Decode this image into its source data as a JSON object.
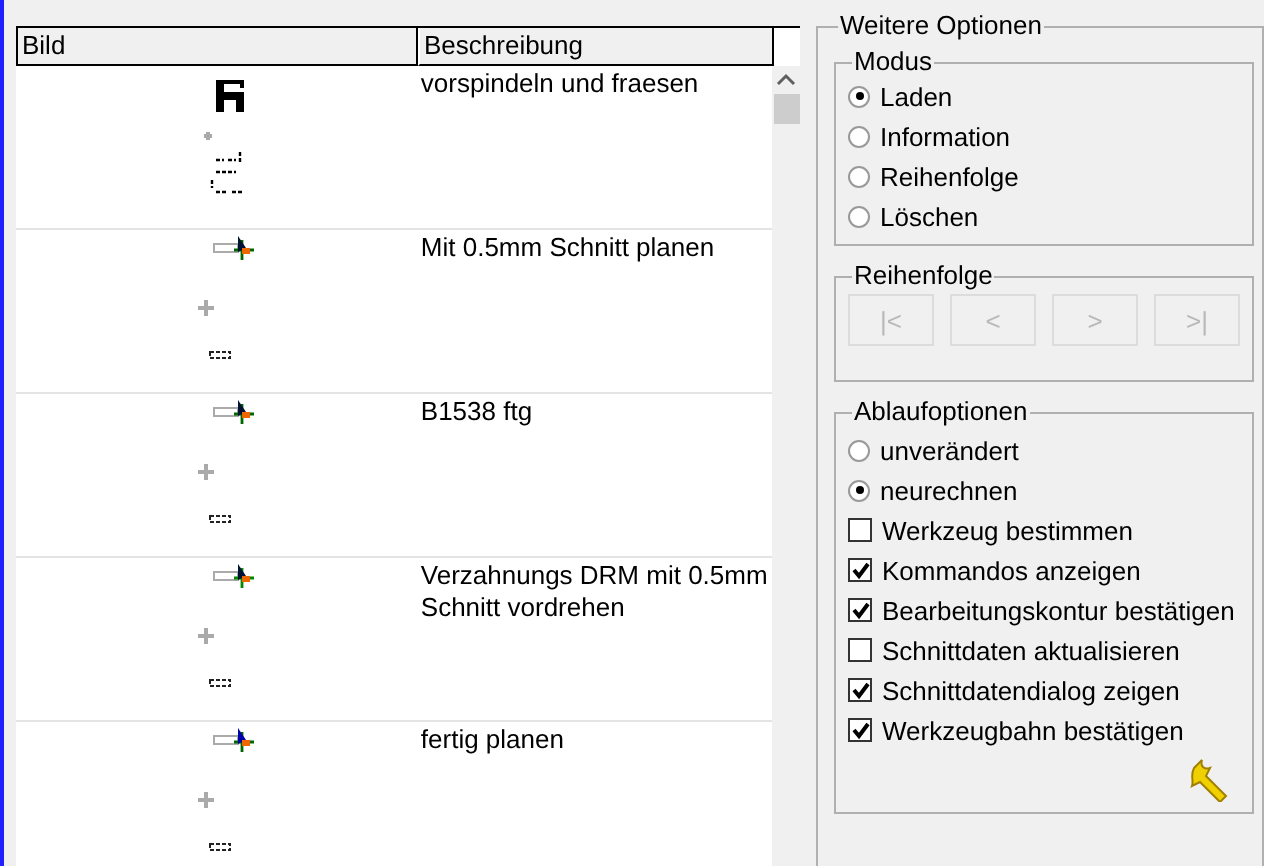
{
  "table": {
    "columns": [
      "Bild",
      "Beschreibung"
    ],
    "rows": [
      {
        "description": "vorspindeln und fraesen"
      },
      {
        "description": "Mit  0.5mm Schnitt planen"
      },
      {
        "description": "B1538 ftg"
      },
      {
        "description": "Verzahnungs DRM mit 0.5mm Schnitt vordrehen"
      },
      {
        "description": "fertig planen"
      }
    ]
  },
  "options": {
    "title": "Weitere Optionen",
    "mode": {
      "title": "Modus",
      "options": [
        {
          "label": "Laden",
          "selected": true
        },
        {
          "label": "Information",
          "selected": false
        },
        {
          "label": "Reihenfolge",
          "selected": false
        },
        {
          "label": "Löschen",
          "selected": false
        }
      ]
    },
    "order": {
      "title": "Reihenfolge",
      "buttons": [
        {
          "label": "|<",
          "disabled": true
        },
        {
          "label": "<",
          "disabled": true
        },
        {
          "label": ">",
          "disabled": true
        },
        {
          "label": ">|",
          "disabled": true
        }
      ]
    },
    "flow": {
      "title": "Ablaufoptionen",
      "radios": [
        {
          "label": "unverändert",
          "selected": false
        },
        {
          "label": "neurechnen",
          "selected": true
        }
      ],
      "checkboxes": [
        {
          "label": "Werkzeug bestimmen",
          "checked": false
        },
        {
          "label": "Kommandos anzeigen",
          "checked": true
        },
        {
          "label": "Bearbeitungskontur bestätigen",
          "checked": true
        },
        {
          "label": "Schnittdaten aktualisieren",
          "checked": false
        },
        {
          "label": "Schnittdatendialog zeigen",
          "checked": true
        },
        {
          "label": "Werkzeugbahn bestätigen",
          "checked": true
        }
      ]
    }
  }
}
